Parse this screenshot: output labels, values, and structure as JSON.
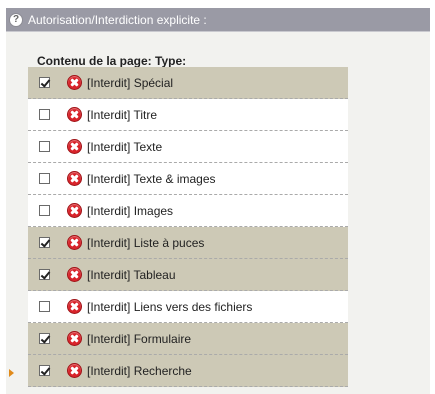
{
  "header": {
    "help_icon": "?",
    "title": "Autorisation/Interdiction explicite :"
  },
  "section": {
    "label": "Contenu de la page: Type:"
  },
  "items": [
    {
      "label": "[Interdit] Spécial",
      "checked": true
    },
    {
      "label": "[Interdit] Titre",
      "checked": false
    },
    {
      "label": "[Interdit] Texte",
      "checked": false
    },
    {
      "label": "[Interdit] Texte & images",
      "checked": false
    },
    {
      "label": "[Interdit] Images",
      "checked": false
    },
    {
      "label": "[Interdit] Liste à puces",
      "checked": true
    },
    {
      "label": "[Interdit] Tableau",
      "checked": true
    },
    {
      "label": "[Interdit] Liens vers des fichiers",
      "checked": false
    },
    {
      "label": "[Interdit] Formulaire",
      "checked": true
    },
    {
      "label": "[Interdit] Recherche",
      "checked": true
    }
  ],
  "colors": {
    "header_bg": "#9a9aa5",
    "checked_row_bg": "#cdc9b6",
    "forbid_icon": "#d9242b",
    "pointer": "#e08a1a"
  },
  "icons": {
    "row_icon": "forbidden-x-icon",
    "pointer": "arrow-right-icon"
  }
}
